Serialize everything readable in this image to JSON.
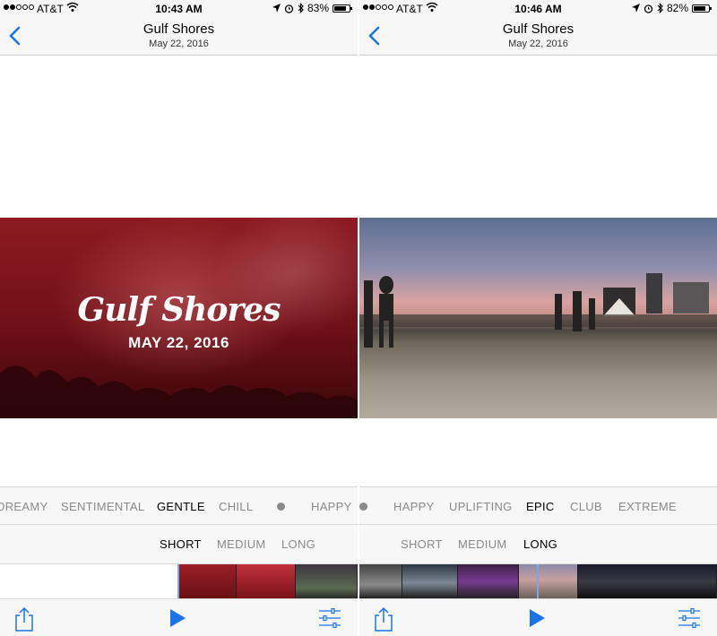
{
  "left": {
    "status": {
      "carrier": "AT&T",
      "time": "10:43 AM",
      "battery": "83%",
      "battery_level": 0.83
    },
    "nav": {
      "title": "Gulf Shores",
      "subtitle": "May 22, 2016"
    },
    "media": {
      "title": "Gulf Shores",
      "date": "MAY 22, 2016"
    },
    "moods": [
      "DREAMY",
      "SENTIMENTAL",
      "GENTLE",
      "CHILL",
      "HAPPY"
    ],
    "selected_mood": "GENTLE",
    "lengths": [
      "SHORT",
      "MEDIUM",
      "LONG"
    ],
    "selected_length": "SHORT"
  },
  "right": {
    "status": {
      "carrier": "AT&T",
      "time": "10:46 AM",
      "battery": "82%",
      "battery_level": 0.82
    },
    "nav": {
      "title": "Gulf Shores",
      "subtitle": "May 22, 2016"
    },
    "moods": [
      "HAPPY",
      "UPLIFTING",
      "EPIC",
      "CLUB",
      "EXTREME"
    ],
    "selected_mood": "EPIC",
    "lengths": [
      "SHORT",
      "MEDIUM",
      "LONG"
    ],
    "selected_length": "LONG"
  },
  "colors": {
    "accent": "#1a73e8",
    "toolbar_bg": "#f7f7f7",
    "mood_inactive": "#8a8a8a"
  },
  "icons": [
    "back-chevron-icon",
    "wifi-icon",
    "location-arrow-icon",
    "alarm-icon",
    "bluetooth-icon",
    "battery-icon",
    "share-icon",
    "play-icon",
    "adjust-sliders-icon"
  ]
}
